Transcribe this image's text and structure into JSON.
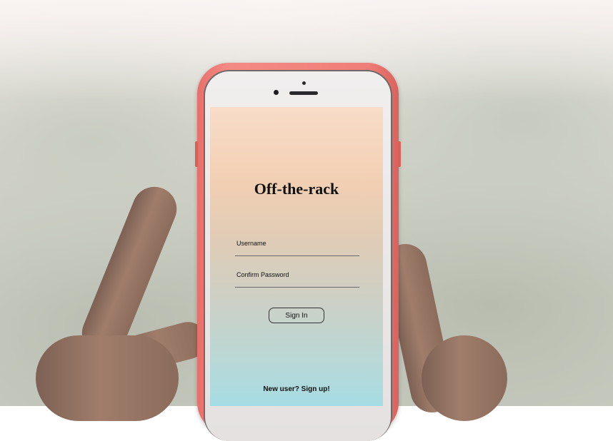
{
  "app": {
    "title": "Off-the-rack"
  },
  "form": {
    "username_label": "Username",
    "confirm_password_label": "Confirm Password",
    "sign_in_label": "Sign In",
    "signup_link": "New user? Sign up!"
  },
  "colors": {
    "phone_case": "#f07d78",
    "screen_top": "#f8dcc8",
    "screen_bottom": "#a6dce4"
  }
}
